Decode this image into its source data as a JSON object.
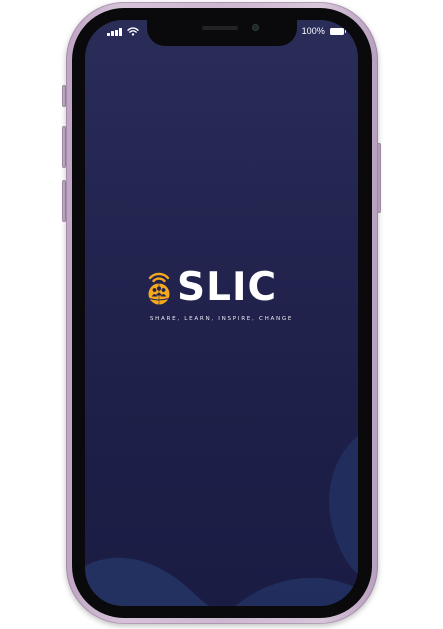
{
  "status_bar": {
    "battery_percent": "100%",
    "icons": [
      "cellular-signal-icon",
      "wifi-icon",
      "battery-icon"
    ]
  },
  "splash": {
    "logo_text": "SLIC",
    "logo_icon": "globe-people-icon",
    "tagline": "SHARE, LEARN, INSPIRE, CHANGE"
  },
  "colors": {
    "background": "#1f2150",
    "logo_icon": "#f5a81c",
    "logo_text": "#ffffff",
    "phone_frame": "#cfbcd3",
    "wave": "#263566"
  }
}
